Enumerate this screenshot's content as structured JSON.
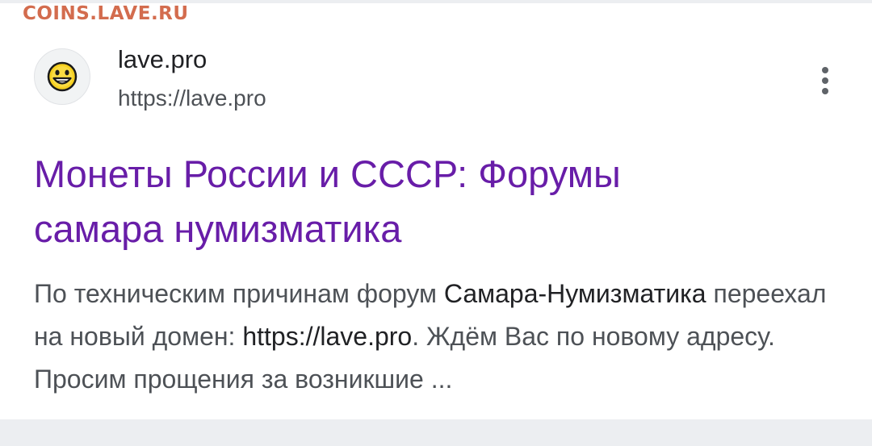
{
  "watermark": {
    "text": "COINS.LAVE.RU",
    "color": "#d36c4e"
  },
  "result": {
    "site_name": "lave.pro",
    "site_url": "https://lave.pro",
    "favicon": "smiley-face-icon",
    "more_icon": "more-vert-icon",
    "title_line1": "Монеты России и СССР: Форумы",
    "title_line2": "самара нумизматика",
    "title_color": "#681da8",
    "snippet": {
      "part1": "По техническим причинам форум ",
      "highlight1": "Самара-Нумизматика",
      "part2": " переехал на новый домен: ",
      "highlight2": "https://lave.pro",
      "part3": ". Ждём Вас по новому адресу. Просим прощения за возникшие ..."
    }
  }
}
